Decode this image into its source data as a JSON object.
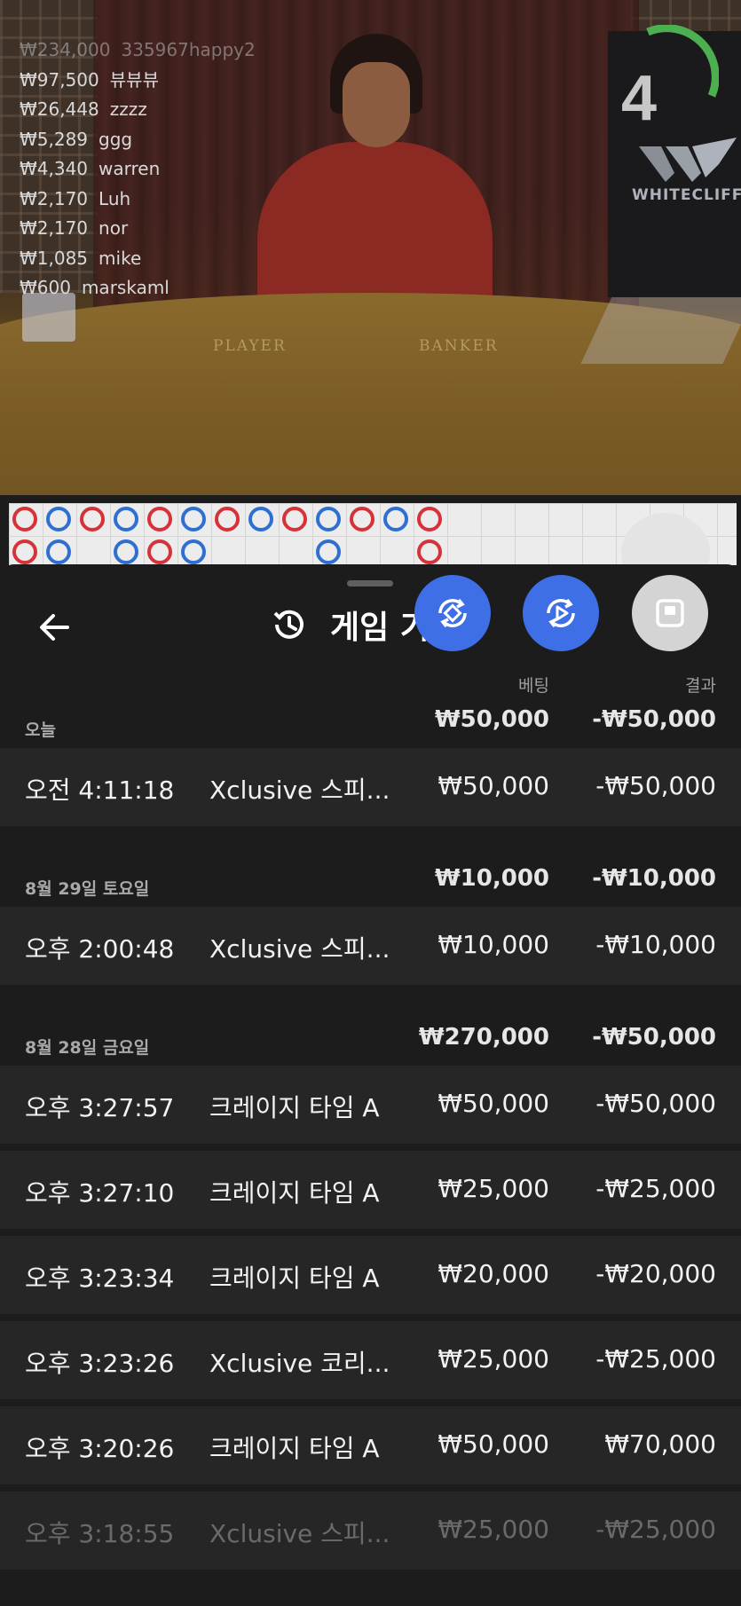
{
  "video": {
    "timer": "4",
    "logo_text": "WHITECLIFF",
    "felt_player": "PLAYER",
    "felt_banker": "BANKER",
    "ticker": [
      {
        "amount": "₩234,000",
        "name": "335967happy2",
        "faded": true
      },
      {
        "amount": "₩97,500",
        "name": "뷰뷰뷰"
      },
      {
        "amount": "₩26,448",
        "name": "zzzz"
      },
      {
        "amount": "₩5,289",
        "name": "ggg"
      },
      {
        "amount": "₩4,340",
        "name": "warren"
      },
      {
        "amount": "₩2,170",
        "name": "Luh"
      },
      {
        "amount": "₩2,170",
        "name": "nor"
      },
      {
        "amount": "₩1,085",
        "name": "mike"
      },
      {
        "amount": "₩600",
        "name": "marskaml"
      }
    ]
  },
  "road": {
    "top_row": [
      "r",
      "b",
      "r",
      "b",
      "r",
      "b",
      "r",
      "b",
      "r",
      "b",
      "r",
      "b",
      "r"
    ],
    "bottom_row": [
      "r",
      "b",
      "",
      "b",
      "r",
      "b",
      "",
      "",
      "",
      "b",
      "",
      "",
      "r"
    ]
  },
  "header": {
    "title": "게임 기록"
  },
  "columns": {
    "bet": "베팅",
    "result": "결과"
  },
  "groups": [
    {
      "date": "오늘",
      "bet_total": "₩50,000",
      "result_total": "-₩50,000",
      "rows": [
        {
          "time": "오전 4:11:18",
          "game": "Xclusive 스피...",
          "bet": "₩50,000",
          "result": "-₩50,000"
        }
      ]
    },
    {
      "date": "8월 29일 토요일",
      "bet_total": "₩10,000",
      "result_total": "-₩10,000",
      "rows": [
        {
          "time": "오후 2:00:48",
          "game": "Xclusive 스피...",
          "bet": "₩10,000",
          "result": "-₩10,000"
        }
      ]
    },
    {
      "date": "8월 28일 금요일",
      "bet_total": "₩270,000",
      "result_total": "-₩50,000",
      "rows": [
        {
          "time": "오후 3:27:57",
          "game": "크레이지 타임 A",
          "bet": "₩50,000",
          "result": "-₩50,000"
        },
        {
          "time": "오후 3:27:10",
          "game": "크레이지 타임 A",
          "bet": "₩25,000",
          "result": "-₩25,000"
        },
        {
          "time": "오후 3:23:34",
          "game": "크레이지 타임 A",
          "bet": "₩20,000",
          "result": "-₩20,000"
        },
        {
          "time": "오후 3:23:26",
          "game": "Xclusive 코리...",
          "bet": "₩25,000",
          "result": "-₩25,000"
        },
        {
          "time": "오후 3:20:26",
          "game": "크레이지 타임 A",
          "bet": "₩50,000",
          "result": "₩70,000"
        },
        {
          "time": "오후 3:18:55",
          "game": "Xclusive 스피...",
          "bet": "₩25,000",
          "result": "-₩25,000",
          "faded": true
        }
      ]
    }
  ],
  "colors": {
    "accent_blue": "#3f6fe6",
    "bead_red": "#d6323a",
    "bead_blue": "#2f6fd0",
    "sheet_bg": "#1c1c1c",
    "row_bg": "#262626"
  }
}
